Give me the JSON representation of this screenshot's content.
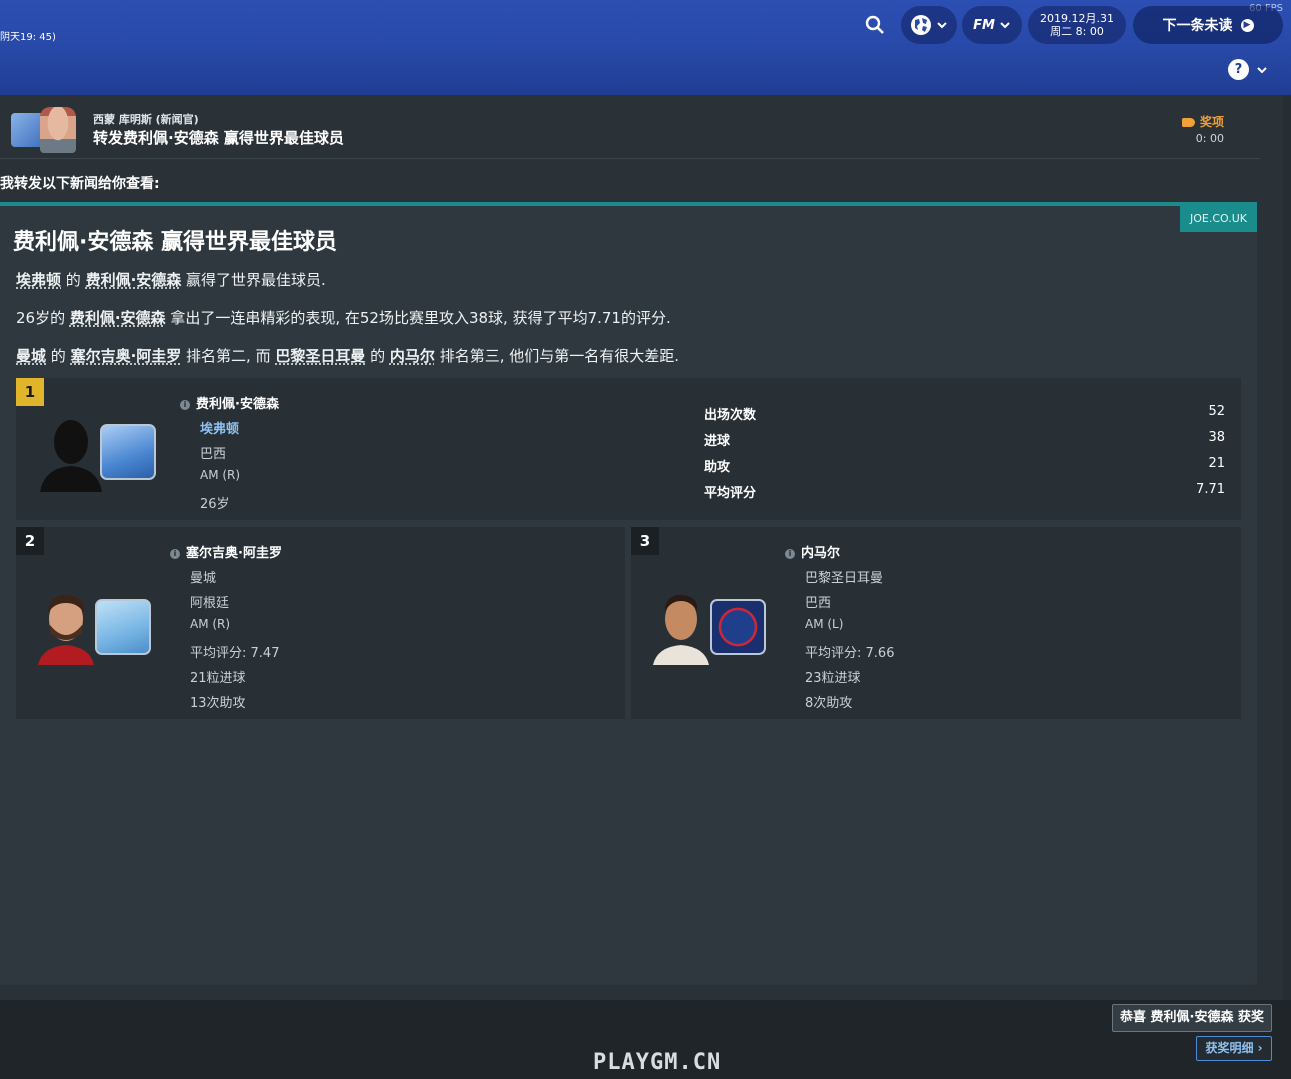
{
  "topbar": {
    "game_time": "阴天19: 45)",
    "fps": "60 FPS",
    "date_line1": "2019.12月.31",
    "date_line2": "周二 8: 00",
    "fm_label": "FM",
    "next_label": "下一条未读",
    "help_label": "?"
  },
  "message": {
    "sender": "西蒙 库明斯 (新闻官)",
    "subject": "转发费利佩·安德森 赢得世界最佳球员",
    "tag_label": "奖项",
    "tag_time": "0: 00",
    "intro": "我转发以下新闻给你查看:"
  },
  "article": {
    "source": "JOE.CO.UK",
    "title": "费利佩·安德森 赢得世界最佳球员",
    "p1": {
      "club": "埃弗顿",
      "mid1": " 的 ",
      "player": "费利佩·安德森",
      "tail": " 赢得了世界最佳球员."
    },
    "p2": {
      "pre": "26岁的 ",
      "player": "费利佩·安德森",
      "tail": " 拿出了一连串精彩的表现, 在52场比赛里攻入38球, 获得了平均7.71的评分."
    },
    "p3": {
      "club2": "曼城",
      "of": " 的 ",
      "player2": "塞尔吉奥·阿圭罗",
      "mid": " 排名第二, 而 ",
      "club3": "巴黎圣日耳曼",
      "of2": " 的 ",
      "player3": "内马尔",
      "tail": " 排名第三, 他们与第一名有很大差距."
    }
  },
  "players": [
    {
      "rank": "1",
      "name": "费利佩·安德森",
      "club": "埃弗顿",
      "nation": "巴西",
      "position": "AM (R)",
      "age": "26岁",
      "stats": [
        {
          "label": "出场次数",
          "value": "52"
        },
        {
          "label": "进球",
          "value": "38"
        },
        {
          "label": "助攻",
          "value": "21"
        },
        {
          "label": "平均评分",
          "value": "7.71"
        }
      ]
    },
    {
      "rank": "2",
      "name": "塞尔吉奥·阿圭罗",
      "club": "曼城",
      "nation": "阿根廷",
      "position": "AM (R)",
      "rating_label": "平均评分",
      "rating": ": 7.47",
      "goals": "21粒进球",
      "assists": "13次助攻"
    },
    {
      "rank": "3",
      "name": "内马尔",
      "club": "巴黎圣日耳曼",
      "nation": "巴西",
      "position": "AM (L)",
      "rating_label": "平均评分",
      "rating": ": 7.66",
      "goals": "23粒进球",
      "assists": "8次助攻"
    }
  ],
  "bottom": {
    "congrats": "恭喜 费利佩·安德森 获奖",
    "details": "获奖明细 ›",
    "watermark": "PLAYGM.CN"
  },
  "icons": [
    "search-icon",
    "globe-icon",
    "chevron-down-icon",
    "help-icon",
    "info-icon",
    "tag-icon",
    "arrow-right-icon"
  ],
  "colors": {
    "accent_teal": "#1a8c8c",
    "rank_gold": "#e0b52a",
    "award_orange": "#f0a13a",
    "link_blue": "#8ec1f2"
  }
}
